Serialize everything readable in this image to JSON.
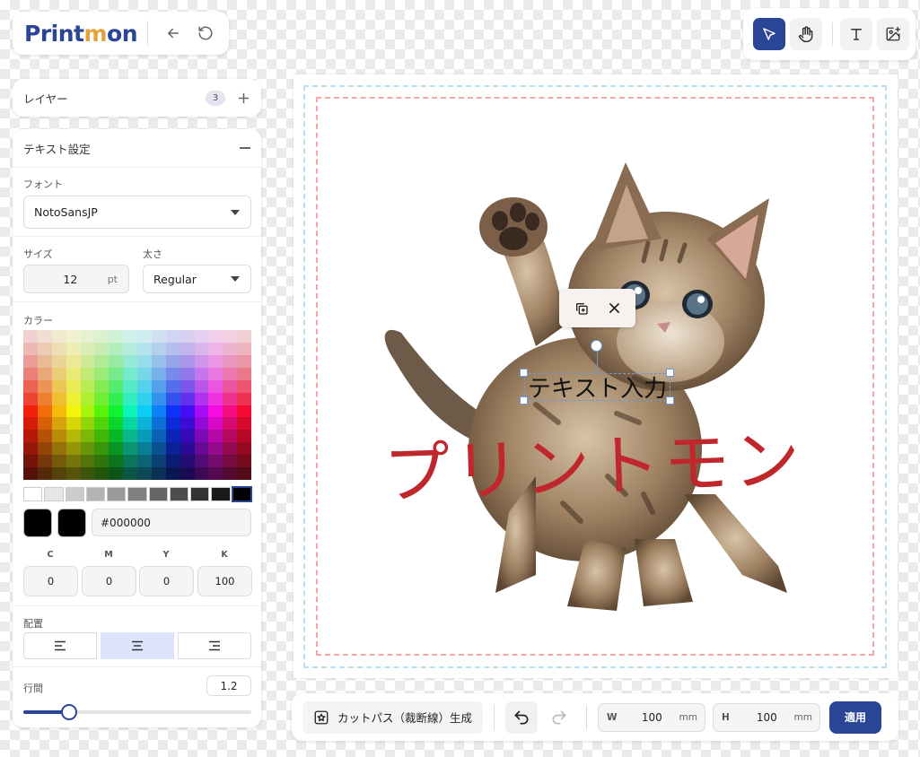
{
  "app": {
    "logo_part1": "Print",
    "logo_part2": "m",
    "logo_part3": "on",
    "brand_color": "#2a4596",
    "accent_color": "#e4a33a"
  },
  "layers": {
    "title": "レイヤー",
    "count": "3"
  },
  "text_settings": {
    "title": "テキスト設定",
    "font_label": "フォント",
    "font_value": "NotoSansJP",
    "size_label": "サイズ",
    "size_value": "12",
    "size_unit": "pt",
    "weight_label": "太さ",
    "weight_value": "Regular",
    "color_label": "カラー",
    "hex_value": "#000000",
    "cmyk": [
      {
        "label": "C",
        "value": "0"
      },
      {
        "label": "M",
        "value": "0"
      },
      {
        "label": "Y",
        "value": "0"
      },
      {
        "label": "K",
        "value": "100"
      }
    ],
    "align_label": "配置",
    "align_selected": "center",
    "line_height_label": "行間",
    "line_height_value": "1.2",
    "line_height_slider_fraction": 0.2
  },
  "canvas": {
    "image_label": "kitten-photo",
    "sample_text": "プリントモン",
    "sample_text_color": "#c0272d",
    "selected_text": "テキスト入力"
  },
  "bottom_bar": {
    "cutpath_label": "カットパス（裁断線）生成",
    "width_key": "W",
    "width_value": "100",
    "height_key": "H",
    "height_value": "100",
    "unit": "mm",
    "apply_label": "適用"
  }
}
